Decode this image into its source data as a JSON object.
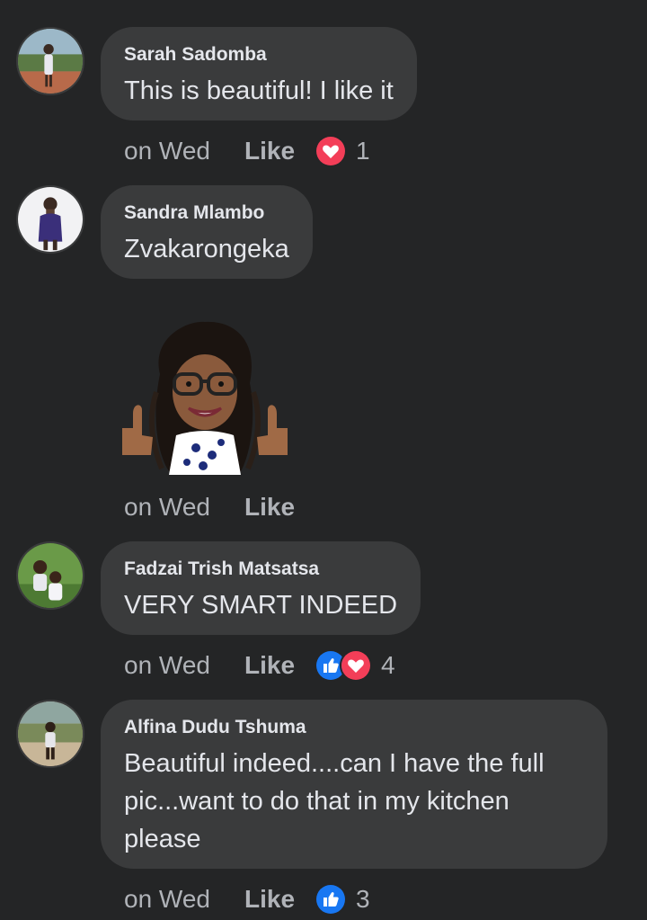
{
  "comments": [
    {
      "author": "Sarah Sadomba",
      "text": "This is beautiful! I like it",
      "time": "on Wed",
      "like_label": "Like",
      "reactions": [
        "love-icon"
      ],
      "reaction_count": "1"
    },
    {
      "author": "Sandra Mlambo",
      "text": "Zvakarongeka",
      "sticker": "thumbs-up-avatar-sticker",
      "time": "on Wed",
      "like_label": "Like"
    },
    {
      "author": "Fadzai Trish Matsatsa",
      "text": "VERY SMART INDEED",
      "time": "on Wed",
      "like_label": "Like",
      "reactions": [
        "like-icon",
        "love-icon"
      ],
      "reaction_count": "4"
    },
    {
      "author": "Alfina Dudu Tshuma",
      "text": "Beautiful indeed....can I have the full\npic...want to do that in my kitchen\nplease",
      "time": "on Wed",
      "like_label": "Like",
      "reactions": [
        "like-icon"
      ],
      "reaction_count": "3"
    }
  ],
  "colors": {
    "background": "#242526",
    "bubble": "#3a3b3c",
    "primary_text": "#e4e6eb",
    "secondary_text": "#b0b3b8",
    "like_blue": "#1877f2",
    "love_red": "#f33e58"
  }
}
